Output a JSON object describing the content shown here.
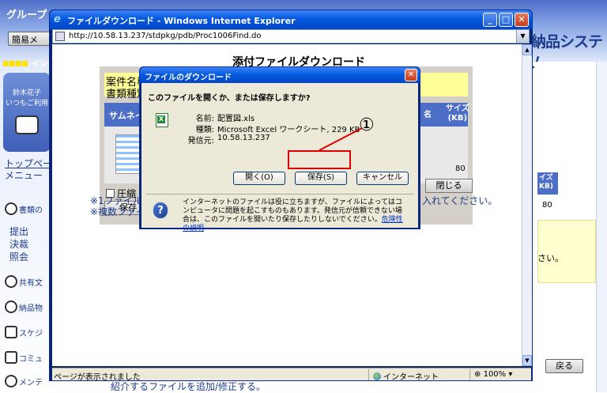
{
  "background": {
    "app_title": "グループ",
    "simple_button": "簡易メ",
    "system_name": "納品システム",
    "info_bar": "インフ",
    "user_name": "鈴木花子",
    "user_sub": "いつもご利用",
    "top_link": "トップペー",
    "menu_label": "メニュー",
    "side_items": [
      {
        "label": "書類の",
        "icon": "document-icon"
      },
      {
        "label": "共有文",
        "icon": "shared-doc-icon"
      },
      {
        "label": "納品物",
        "icon": "delivery-icon"
      },
      {
        "label": "スケジ",
        "icon": "calendar-icon"
      },
      {
        "label": "コミュ",
        "icon": "mail-icon"
      },
      {
        "label": "メンテ",
        "icon": "maintenance-icon"
      }
    ],
    "sub_items": [
      "提出",
      "決裁",
      "照会"
    ],
    "right_size_header": "イズ\nKB)",
    "right_size_value": "80",
    "right_text": "さい。",
    "back_button": "戻る",
    "bottom_text": "紹介するファイルを追加/修正する。"
  },
  "ie": {
    "title": "ファイルダウンロード - Windows Internet Explorer",
    "url": "http://10.58.13.237/stdpkg/pdb/Proc1006Find.do",
    "status_text": "ページが表示されました",
    "zone": "インターネット",
    "zoom": "100%"
  },
  "page": {
    "heading": "添付ファイルダウンロード",
    "case_name": "案件名称",
    "doc_type": "書類種別",
    "col_thumbnail": "サムネイ",
    "col_name": "名",
    "col_size": "サイズ\n(KB)",
    "size_value": "80",
    "compress_label": "圧縮",
    "save_button": "保存",
    "close_button": "閉じる",
    "note1": "※1ファイルを",
    "note1_tail": "入れてください。",
    "note2": "※複数ファイ"
  },
  "dialog": {
    "title": "ファイルのダウンロード",
    "question": "このファイルを開くか、または保存しますか?",
    "name_label": "名前:",
    "name_value": "配置図.xls",
    "type_label": "種類:",
    "type_value": "Microsoft Excel ワークシート, 229 KB",
    "source_label": "発信元:",
    "source_value": "10.58.13.237",
    "open_button": "開く(O)",
    "save_button": "保存(S)",
    "cancel_button": "キャンセル",
    "warning": "インターネットのファイルは役に立ちますが、ファイルによってはコンピュータに問題を起こすものもあります。発信元が信頼できない場合は、このファイルを開いたり保存したりしないでください。",
    "warning_link": "危険性の説明"
  },
  "annotation": {
    "number": "①",
    "color": "#e00000"
  }
}
